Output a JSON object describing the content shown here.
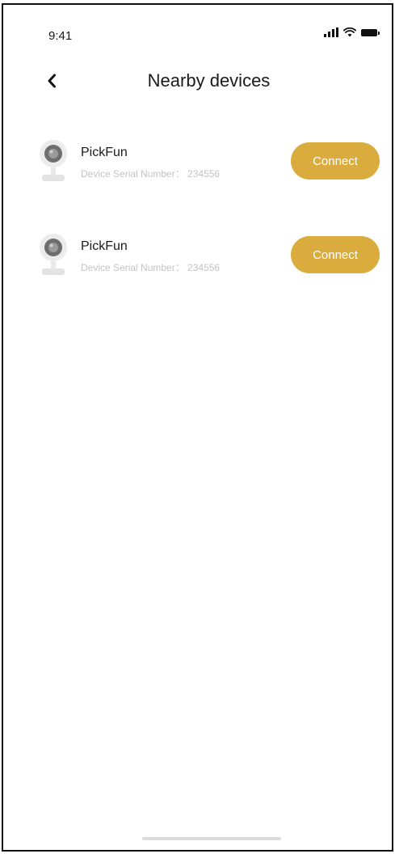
{
  "status_bar": {
    "time": "9:41"
  },
  "header": {
    "title": "Nearby devices",
    "back_icon": "chevron-left-icon"
  },
  "devices": [
    {
      "name": "PickFun",
      "serial": "Device Serial Number： 234556",
      "button_label": "Connect",
      "icon": "camera-icon"
    },
    {
      "name": "PickFun",
      "serial": "Device Serial Number： 234556",
      "button_label": "Connect",
      "icon": "camera-icon"
    }
  ],
  "colors": {
    "accent": "#d9ac3d",
    "serial_text": "#c4c4c4",
    "title_text": "#1a1a1a"
  }
}
